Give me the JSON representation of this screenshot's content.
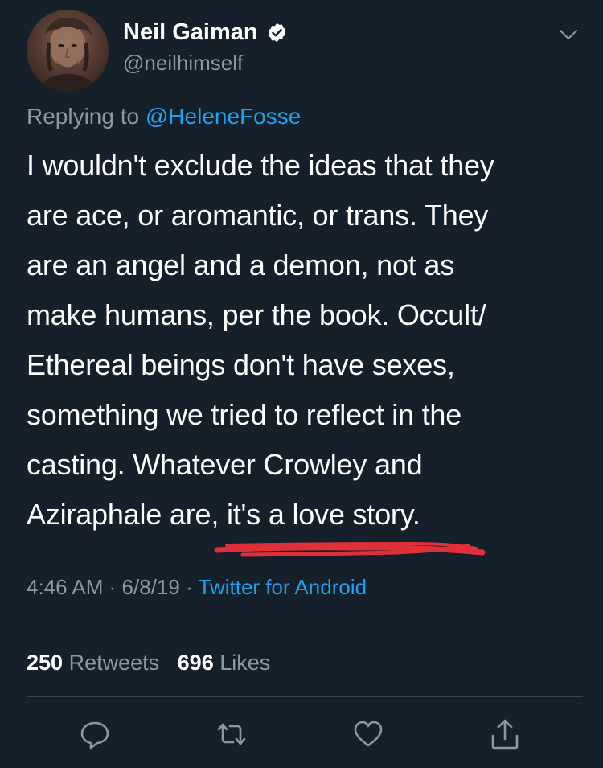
{
  "author": {
    "display_name": "Neil Gaiman",
    "handle": "@neilhimself",
    "verified": true
  },
  "reply": {
    "prefix": "Replying to",
    "mention": "@HeleneFosse"
  },
  "tweet": {
    "lines": [
      "I wouldn't exclude the ideas that they",
      "are ace, or aromantic, or trans. They",
      "are an angel and a demon, not as",
      "make humans, per the book. Occult/",
      "Ethereal beings don't have sexes,",
      "something we tried to reflect in the",
      "casting. Whatever Crowley and",
      "Aziraphale are, it's a love story."
    ]
  },
  "meta": {
    "time": "4:46 AM",
    "separator": "·",
    "date": "6/8/19",
    "source": "Twitter for Android"
  },
  "stats": {
    "retweets_count": "250",
    "retweets_label": "Retweets",
    "likes_count": "696",
    "likes_label": "Likes"
  },
  "actions": [
    "reply-icon",
    "retweet-icon",
    "like-icon",
    "share-icon"
  ],
  "colors": {
    "background": "#15202b",
    "link": "#1da1f2",
    "secondary_text": "#8899a6",
    "annotation": "#e0303a"
  }
}
